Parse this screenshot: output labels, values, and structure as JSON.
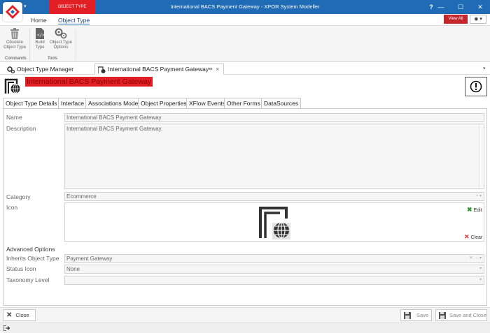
{
  "window": {
    "title": "International BACS Payment Gateway - XPOR System Modeller",
    "context_tab": "OBJECT TYPE",
    "help": "?",
    "minimize": "—",
    "maximize": "☐",
    "close": "✕"
  },
  "ribbon": {
    "tabs": [
      "Home",
      "Object Type"
    ],
    "active_tab": "Object Type",
    "view_all": "View All",
    "eye_dropdown": "◉ ▾",
    "groups": [
      {
        "label": "Commands",
        "buttons": [
          {
            "label1": "Obsolete",
            "label2": "Object Type",
            "icon": "trash-icon"
          }
        ]
      },
      {
        "label": "Tools",
        "buttons": [
          {
            "label1": "Build",
            "label2": "Type",
            "icon": "build-file-icon"
          },
          {
            "label1": "Object Type",
            "label2": "Options",
            "icon": "gears-icon"
          }
        ]
      }
    ]
  },
  "doc_tabs": {
    "items": [
      {
        "label": "Object Type Manager",
        "icon": "gears-icon"
      },
      {
        "label": "International BACS Payment Gateway",
        "icon": "object-type-icon"
      }
    ],
    "pin": "⇹",
    "close": "×",
    "overflow": "▾"
  },
  "header": {
    "title": "International BACS Payment Gateway",
    "alert_symbol": "!"
  },
  "form_tabs": [
    "Object Type Details",
    "Interface",
    "Associations Model",
    "Object Properties",
    "XFlow Events",
    "Other Forms",
    "DataSources"
  ],
  "form": {
    "name_label": "Name",
    "name_value": "International BACS Payment Gateway",
    "description_label": "Description",
    "description_value": "International BACS Payment Gateway.",
    "category_label": "Category",
    "category_value": "Ecommerce",
    "category_ctrl": "+ ▾",
    "icon_label": "Icon",
    "icon_edit": "Edit",
    "icon_clear": "Clear",
    "advanced_label": "Advanced Options",
    "inherits_label": "Inherits Object Type",
    "inherits_value": "Payment Gateway",
    "inherits_ctrl": "✕ ··· ▾",
    "status_icon_label": "Status Icon",
    "status_icon_value": "None",
    "taxonomy_label": "Taxonomy Level",
    "taxonomy_value": "",
    "dd_arrow": "▾"
  },
  "footer": {
    "close": "Close",
    "save": "Save",
    "save_and_close": "Save and Close"
  },
  "colors": {
    "title_bar": "#1f6bb5",
    "context_red": "#e31f26",
    "view_all": "#c4262e"
  }
}
